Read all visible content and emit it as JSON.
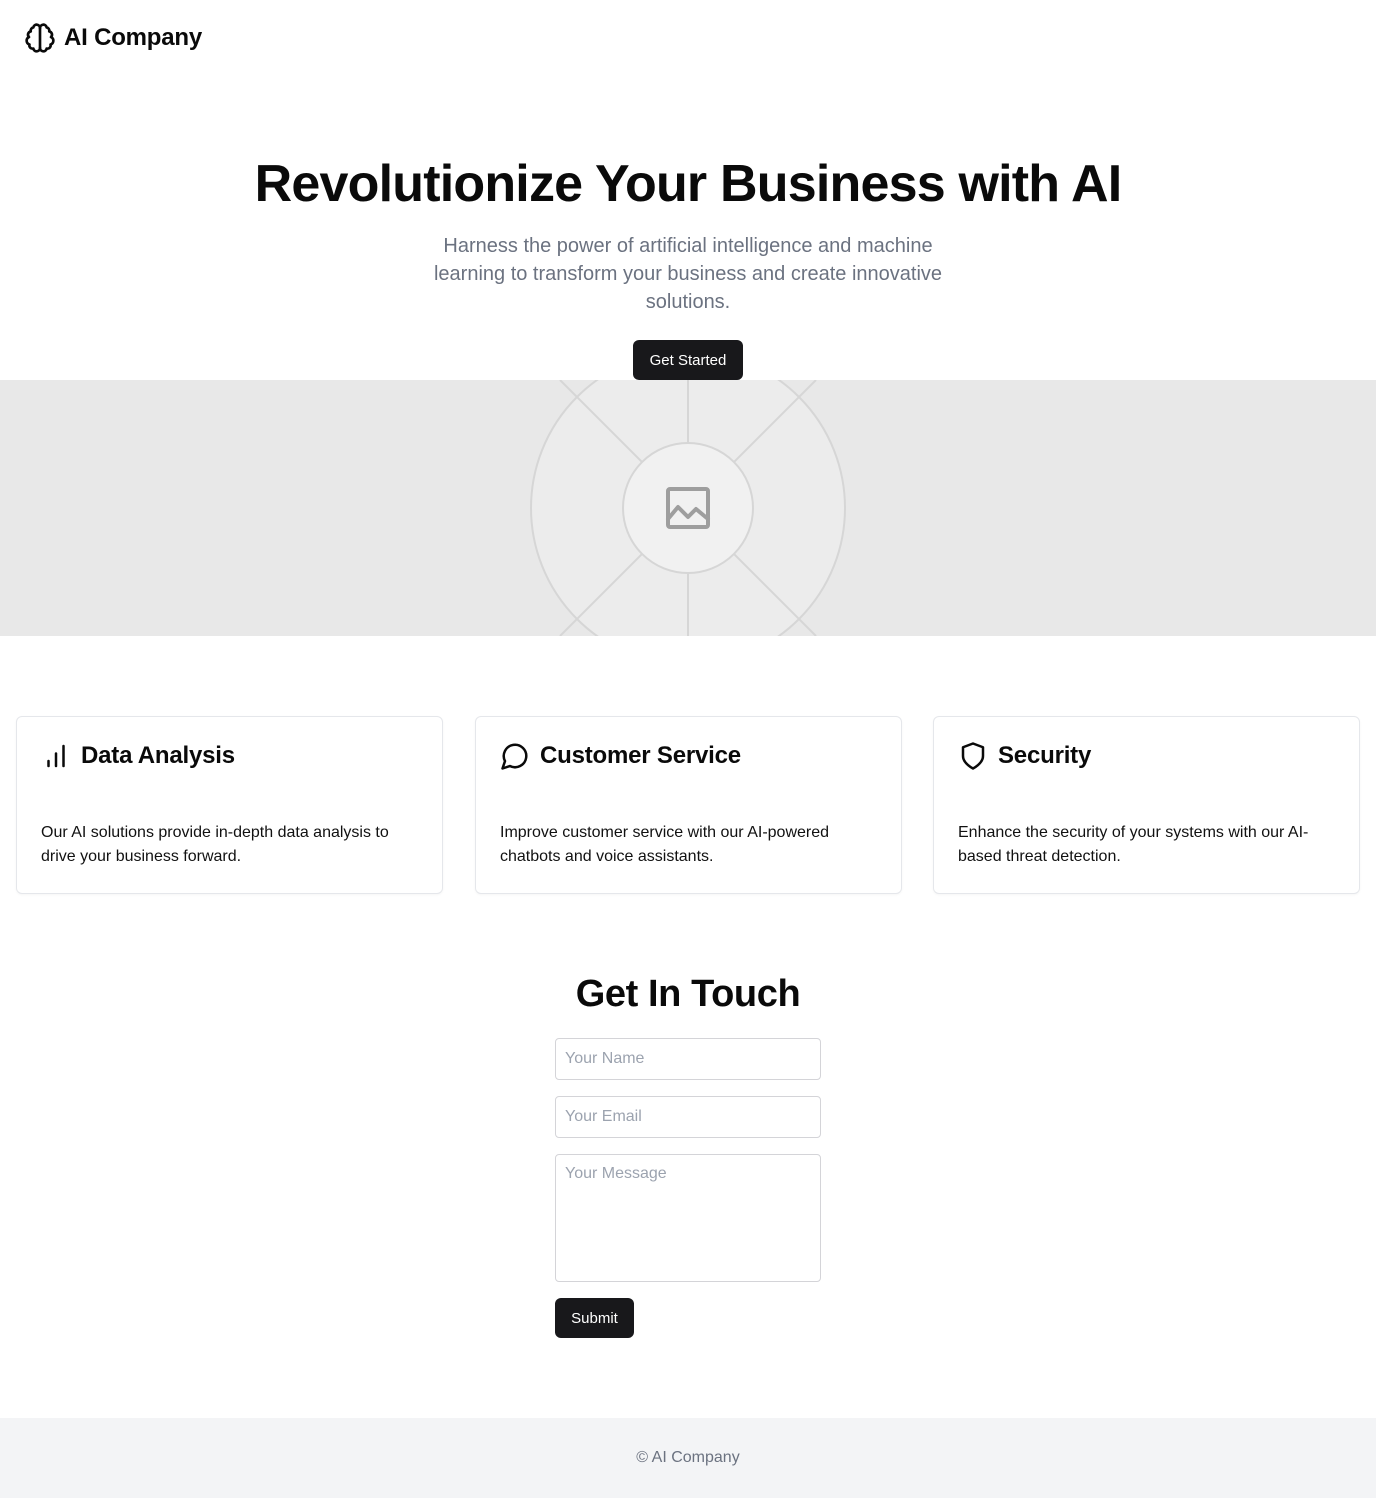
{
  "header": {
    "brand_icon": "brain-icon",
    "brand_name": "AI Company"
  },
  "hero": {
    "title": "Revolutionize Your Business with AI",
    "subtitle": "Harness the power of artificial intelligence and machine learning to transform your business and create innovative solutions.",
    "cta_label": "Get Started",
    "image_icon": "image-placeholder-icon"
  },
  "features": [
    {
      "icon": "bar-chart-icon",
      "title": "Data Analysis",
      "text": "Our AI solutions provide in-depth data analysis to drive your business forward."
    },
    {
      "icon": "message-circle-icon",
      "title": "Customer Service",
      "text": "Improve customer service with our AI-powered chatbots and voice assistants."
    },
    {
      "icon": "shield-icon",
      "title": "Security",
      "text": "Enhance the security of your systems with our AI-based threat detection."
    }
  ],
  "contact": {
    "title": "Get In Touch",
    "name_placeholder": "Your Name",
    "email_placeholder": "Your Email",
    "message_placeholder": "Your Message",
    "submit_label": "Submit"
  },
  "footer": {
    "text": "© AI Company"
  },
  "colors": {
    "primary_button": "#18181b",
    "muted_text": "#6b7280",
    "image_band": "#e8e8e8",
    "footer_bg": "#f3f4f6"
  }
}
